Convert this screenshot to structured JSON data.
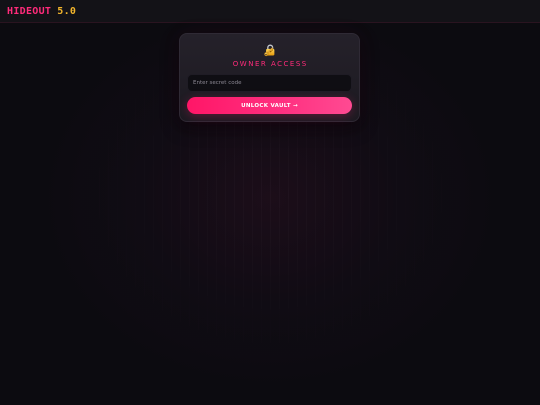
{
  "header": {
    "logo_main": "HIDEOUT",
    "logo_version": "5.0"
  },
  "login_card": {
    "icon": "lock-with-key-icon",
    "title": "OWNER ACCESS",
    "secret_input": {
      "placeholder": "Enter secret code",
      "value": ""
    },
    "unlock_button_label": "UNLOCK VAULT →"
  },
  "colors": {
    "background": "#0c0b10",
    "header_background": "#131217",
    "accent_pink": "#ff2b7a",
    "version_gold": "#f4b62c",
    "placeholder_text": "#8b8792",
    "button_text": "#ffffff"
  }
}
